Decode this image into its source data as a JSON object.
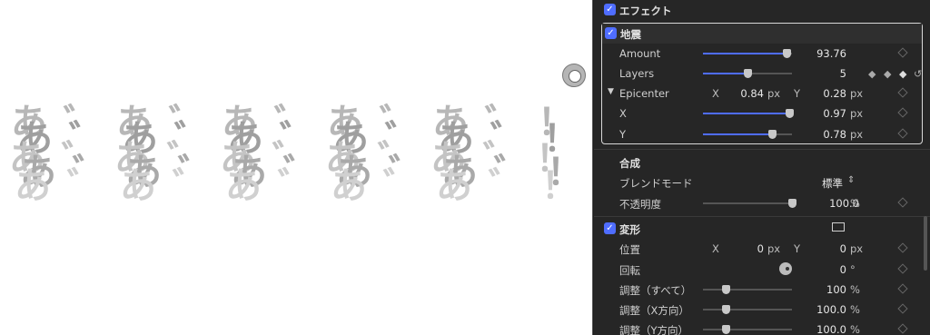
{
  "viewer": {
    "text_glyphs": "あ゛あ゛あ゛あ゛あ゛！！！"
  },
  "inspector": {
    "effects_header": "エフェクト",
    "earthquake": {
      "title": "地震",
      "amount_label": "Amount",
      "amount_value": "93.76",
      "amount_level": 0.94,
      "layers_label": "Layers",
      "layers_value": "5",
      "layers_level": 0.5,
      "epicenter_label": "Epicenter",
      "epicenter_x_label": "X",
      "epicenter_x_value": "0.84",
      "epicenter_y_label": "Y",
      "epicenter_y_value": "0.28",
      "px_unit": "px",
      "x_label": "X",
      "x_value": "0.97",
      "x_level": 0.97,
      "y_label": "Y",
      "y_value": "0.78",
      "y_level": 0.78
    },
    "compositing": {
      "title": "合成",
      "blend_label": "ブレンドモード",
      "blend_value": "標準",
      "blend_arrow": "⌃⌄",
      "opacity_label": "不透明度",
      "opacity_value": "100.0",
      "opacity_unit": "%",
      "opacity_level": 1.0
    },
    "transform": {
      "title": "変形",
      "position_label": "位置",
      "position_x_label": "X",
      "position_x_value": "0",
      "position_y_label": "Y",
      "position_y_value": "0",
      "px_unit": "px",
      "rotation_label": "回転",
      "rotation_value": "0",
      "rotation_unit": "°",
      "scale_all_label": "調整（すべて）",
      "scale_all_value": "100",
      "scale_x_label": "調整（X方向）",
      "scale_x_value": "100.0",
      "scale_y_label": "調整（Y方向）",
      "scale_y_value": "100.0",
      "percent_unit": "%"
    }
  }
}
